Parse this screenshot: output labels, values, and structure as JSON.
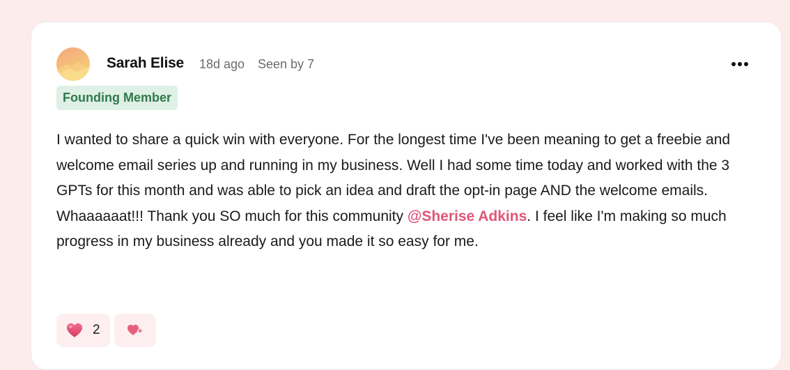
{
  "post": {
    "author": "Sarah Elise",
    "time_ago": "18d ago",
    "seen_by": "Seen by 7",
    "badge": "Founding Member",
    "body_before": "I wanted to share a quick win with everyone. For the longest time I've been meaning to get a freebie and welcome email series up and running in my business. Well I had some time today and worked with the 3 GPTs for this month and was able to pick an idea and draft the opt-in page AND the welcome emails. Whaaaaaat!!! Thank you SO much for this community ",
    "mention": "@Sherise Adkins",
    "body_after": ". I feel like I'm making so much progress in my business already and you made it so easy for me."
  },
  "reactions": {
    "heart_count": "2"
  },
  "icons": {
    "more": "more-horizontal-icon",
    "heart": "heart-icon",
    "add_reaction": "heart-plus-icon"
  },
  "colors": {
    "page_bg": "#fcecec",
    "badge_bg": "#dff0e6",
    "badge_text": "#2f7a4a",
    "mention": "#e0557a",
    "reaction_bg": "#fdeef0"
  }
}
